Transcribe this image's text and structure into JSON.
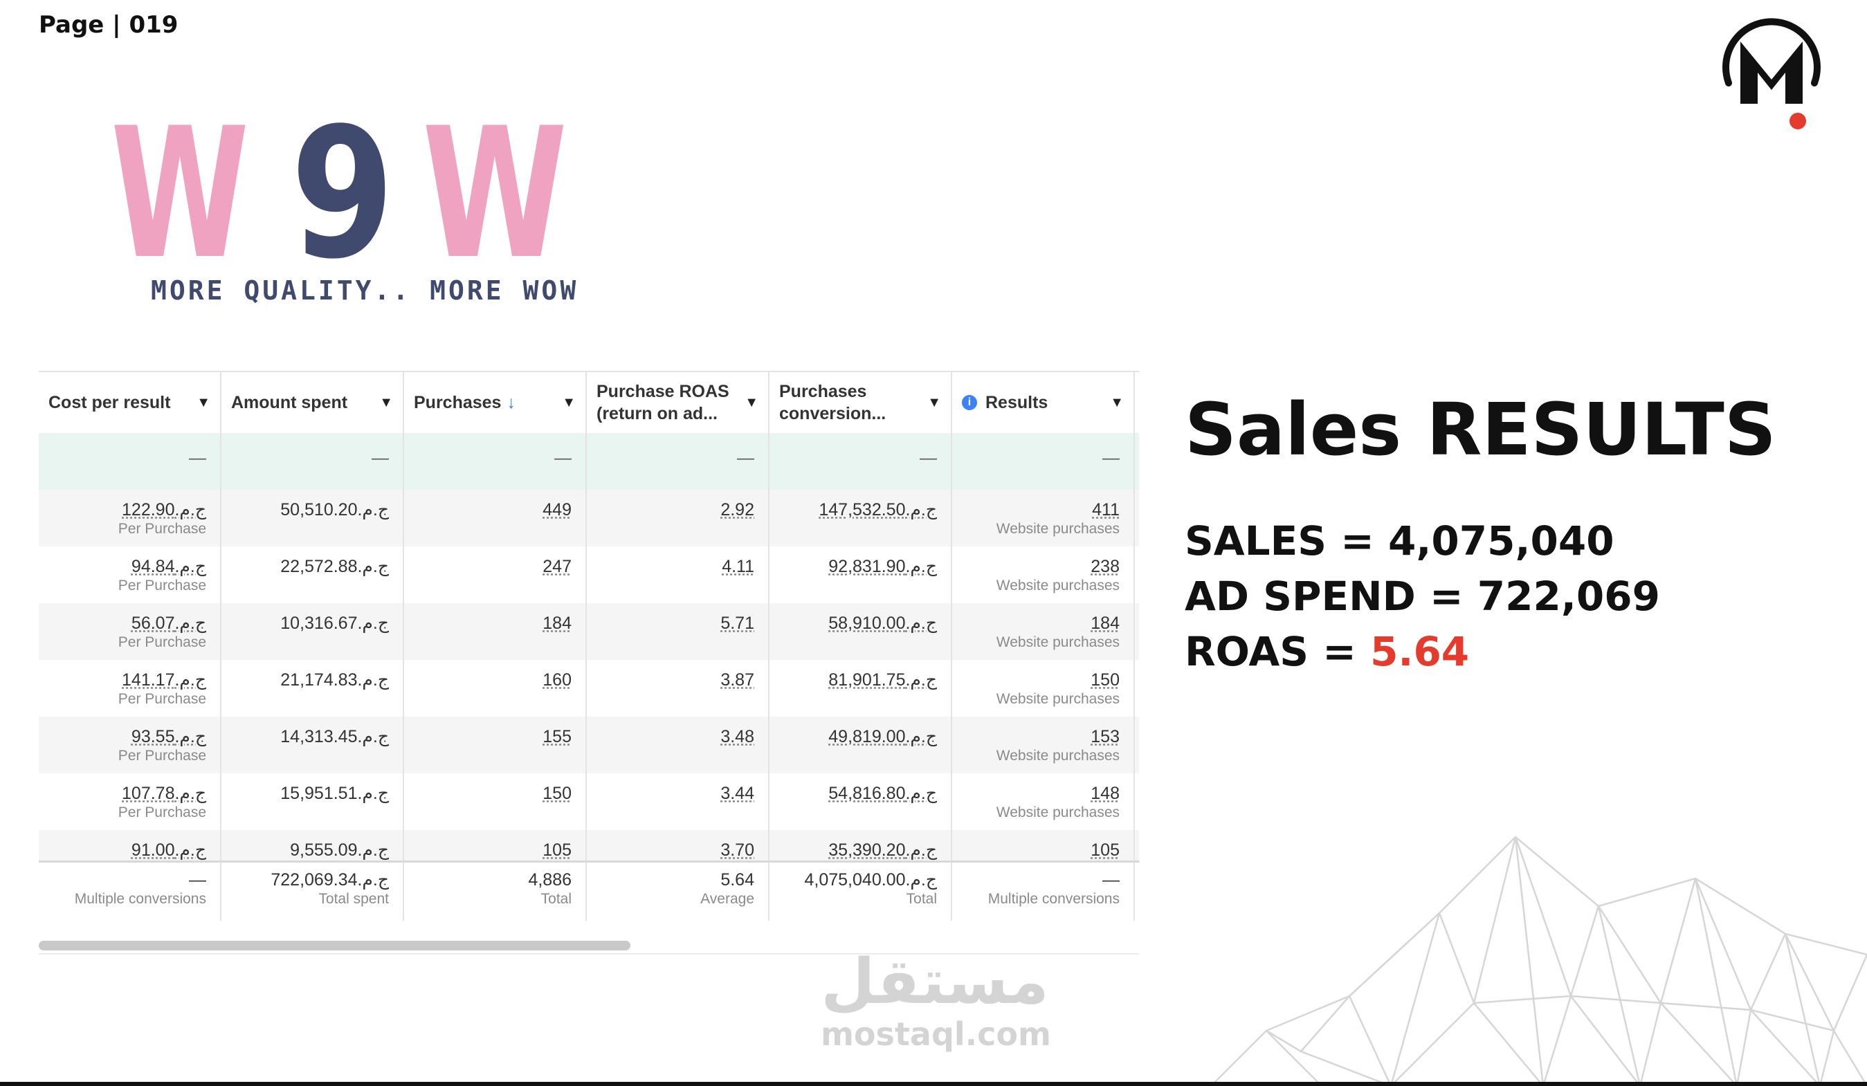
{
  "page_label": "Page | 019",
  "brand": {
    "wow_logo_text": "W9W",
    "tagline": "MORE QUALITY.. MORE WOW",
    "m_logo_letter": "M"
  },
  "colors": {
    "wow_pink": "#f0a3c0",
    "wow_navy": "#3f4a6e",
    "accent_red": "#e43b2c",
    "info_blue": "#3b82f6",
    "row_green": "#e9f5f0"
  },
  "table": {
    "headers": [
      {
        "label": "Cost per result"
      },
      {
        "label": "Amount spent"
      },
      {
        "label": "Purchases",
        "sort_icon": "↓"
      },
      {
        "label": "Purchase ROAS (return on ad..."
      },
      {
        "label": "Purchases conversion..."
      },
      {
        "label": "Results",
        "icon": "i"
      }
    ],
    "empty_row_value": "—",
    "rows": [
      {
        "cost": "ج.م.122.90",
        "cost_sub": "Per Purchase",
        "spent": "ج.م.50,510.20",
        "purchases": "449",
        "roas": "2.92",
        "conv": "ج.م.147,532.50",
        "results": "411",
        "results_sub": "Website purchases"
      },
      {
        "cost": "ج.م.94.84",
        "cost_sub": "Per Purchase",
        "spent": "ج.م.22,572.88",
        "purchases": "247",
        "roas": "4.11",
        "conv": "ج.م.92,831.90",
        "results": "238",
        "results_sub": "Website purchases"
      },
      {
        "cost": "ج.م.56.07",
        "cost_sub": "Per Purchase",
        "spent": "ج.م.10,316.67",
        "purchases": "184",
        "roas": "5.71",
        "conv": "ج.م.58,910.00",
        "results": "184",
        "results_sub": "Website purchases"
      },
      {
        "cost": "ج.م.141.17",
        "cost_sub": "Per Purchase",
        "spent": "ج.م.21,174.83",
        "purchases": "160",
        "roas": "3.87",
        "conv": "ج.م.81,901.75",
        "results": "150",
        "results_sub": "Website purchases"
      },
      {
        "cost": "ج.م.93.55",
        "cost_sub": "Per Purchase",
        "spent": "ج.م.14,313.45",
        "purchases": "155",
        "roas": "3.48",
        "conv": "ج.م.49,819.00",
        "results": "153",
        "results_sub": "Website purchases"
      },
      {
        "cost": "ج.م.107.78",
        "cost_sub": "Per Purchase",
        "spent": "ج.م.15,951.51",
        "purchases": "150",
        "roas": "3.44",
        "conv": "ج.م.54,816.80",
        "results": "148",
        "results_sub": "Website purchases"
      },
      {
        "cost": "ج.م.91.00",
        "cost_sub": "",
        "spent": "ج.م.9,555.09",
        "purchases": "105",
        "roas": "3.70",
        "conv": "ج.م.35,390.20",
        "results": "105",
        "results_sub": ""
      }
    ],
    "totals": {
      "cost": "—",
      "cost_sub": "Multiple conversions",
      "spent": "ج.م.722,069.34",
      "spent_sub": "Total spent",
      "purchases": "4,886",
      "purchases_sub": "Total",
      "roas": "5.64",
      "roas_sub": "Average",
      "conv": "ج.م.4,075,040.00",
      "conv_sub": "Total",
      "results": "—",
      "results_sub": "Multiple conversions"
    }
  },
  "summary": {
    "title": "Sales RESULTS",
    "sales_label": "SALES = ",
    "sales_value": "4,075,040",
    "ad_spend_label": "AD SPEND = ",
    "ad_spend_value": "722,069",
    "roas_label": "ROAS = ",
    "roas_value": "5.64"
  },
  "watermark": {
    "arabic": "مستقل",
    "latin": "mostaql.com"
  }
}
